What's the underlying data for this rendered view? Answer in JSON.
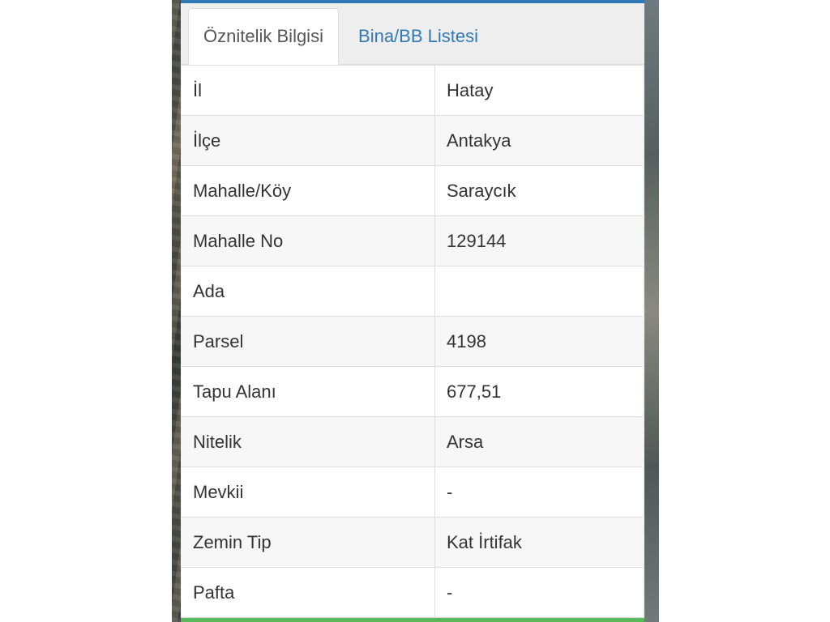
{
  "tabs": {
    "active_label": "Öznitelik Bilgisi",
    "second_label": "Bina/BB Listesi"
  },
  "rows": [
    {
      "key": "İl",
      "value": "Hatay"
    },
    {
      "key": "İlçe",
      "value": "Antakya"
    },
    {
      "key": "Mahalle/Köy",
      "value": "Saraycık"
    },
    {
      "key": "Mahalle No",
      "value": "129144"
    },
    {
      "key": "Ada",
      "value": ""
    },
    {
      "key": "Parsel",
      "value": "4198"
    },
    {
      "key": "Tapu Alanı",
      "value": "677,51"
    },
    {
      "key": "Nitelik",
      "value": "Arsa"
    },
    {
      "key": "Mevkii",
      "value": "-"
    },
    {
      "key": "Zemin Tip",
      "value": "Kat İrtifak"
    },
    {
      "key": "Pafta",
      "value": "-"
    }
  ],
  "colors": {
    "accent": "#2f79b8",
    "bottom_bar": "#5cb85c"
  }
}
